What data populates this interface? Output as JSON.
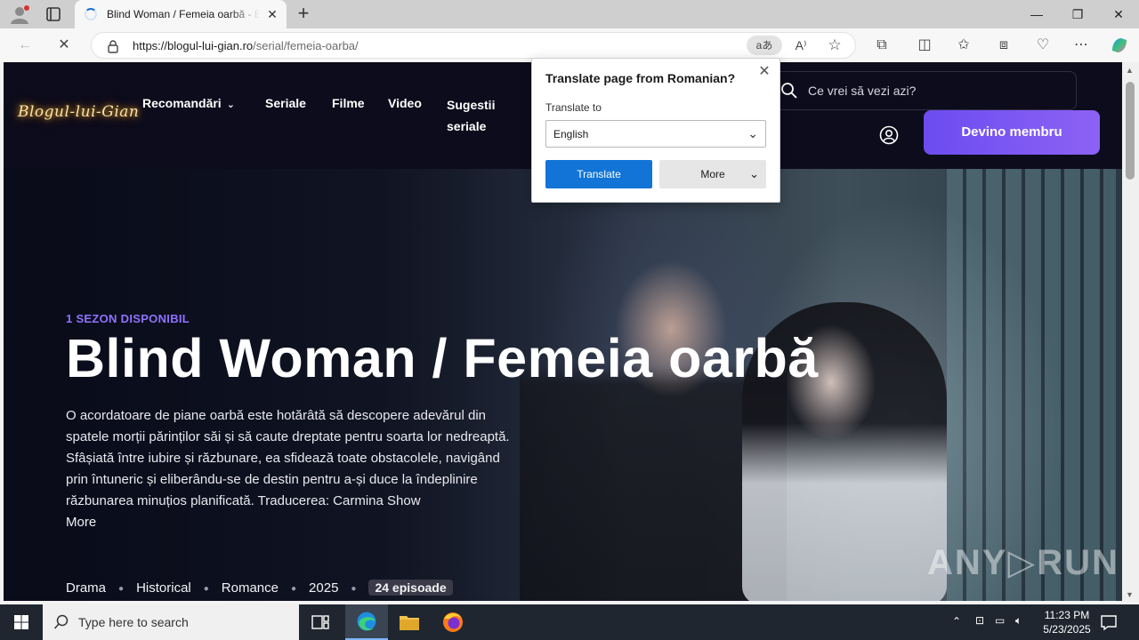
{
  "browser": {
    "tab_title": "Blind Woman / Femeia oarbă - Blogul-lui-Gian",
    "url_host": "https://blogul-lui-gian.ro",
    "url_path": "/serial/femeia-oarba/",
    "translate_chip": "aあ",
    "new_tab": "+",
    "window_controls": [
      "—",
      "❐",
      "✕"
    ]
  },
  "site": {
    "logo": "Blogul-lui-Gian",
    "nav": [
      "Recomandări",
      "Seriale",
      "Filme",
      "Video",
      "Sugestii seriale"
    ],
    "search_placeholder": "Ce vrei să vezi azi?",
    "cta": "Devino membru"
  },
  "hero": {
    "season": "1 SEZON DISPONIBIL",
    "title": "Blind Woman / Femeia oarbă",
    "synopsis": "O acordatoare de piane oarbă este hotărâtă să descopere adevărul din spatele morții părinților săi și să caute dreptate pentru soarta lor nedreaptă. Sfâșiată între iubire și răzbunare, ea sfidează toate obstacolele, navigând prin întuneric și eliberându-se de destin pentru a-și duce la îndeplinire răzbunarea minuțios planificată. Traducerea: Carmina Show",
    "more": "More",
    "tags": [
      "Drama",
      "Historical",
      "Romance",
      "2025"
    ],
    "episodes": "24 episoade"
  },
  "translate_popup": {
    "title": "Translate page from Romanian?",
    "label": "Translate to",
    "selected_language": "English",
    "translate_button": "Translate",
    "more_button": "More"
  },
  "watermark": "ANY▷RUN",
  "taskbar": {
    "search_placeholder": "Type here to search",
    "time": "11:23 PM",
    "date": "5/23/2025"
  },
  "colors": {
    "accent_purple": "#7c5cf2",
    "translate_blue": "#1274d6",
    "page_bg": "#0c0c1c"
  }
}
